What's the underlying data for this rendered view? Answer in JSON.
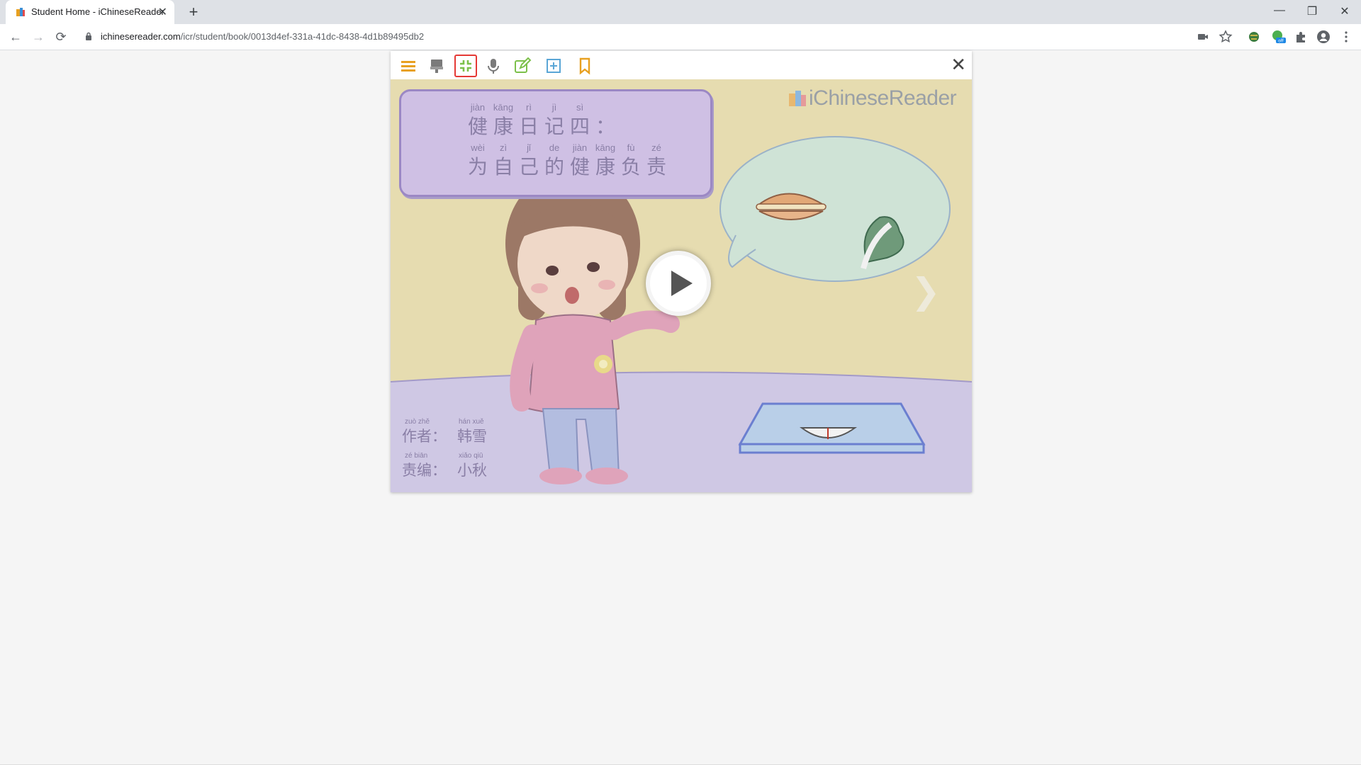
{
  "browser": {
    "tab_title": "Student Home - iChineseReader",
    "url_host": "ichinesereader.com",
    "url_path": "/icr/student/book/0013d4ef-331a-41dc-8438-4d1b89495db2",
    "new_tab_glyph": "+",
    "tab_close_glyph": "✕",
    "window_controls": {
      "minimize": "—",
      "maximize": "❐",
      "close": "✕"
    },
    "nav": {
      "back": "←",
      "forward": "→",
      "reload": "⟳"
    }
  },
  "reader": {
    "close_glyph": "✕",
    "toolbar_icons": [
      "menu-icon",
      "stamp-icon",
      "fullscreen-exit-icon",
      "microphone-icon",
      "edit-icon",
      "add-icon",
      "bookmark-icon"
    ],
    "colors": {
      "accent_orange": "#e8a020",
      "icon_gray": "#7a7a7a",
      "icon_green": "#7cc04a",
      "icon_blue": "#5aa6d6",
      "active_outline": "#e53935"
    },
    "brand": {
      "prefix": "i",
      "name": "ChineseReader"
    },
    "title": {
      "line1": [
        {
          "pinyin": "jiàn",
          "hanzi": "健"
        },
        {
          "pinyin": "kāng",
          "hanzi": "康"
        },
        {
          "pinyin": "rì",
          "hanzi": "日"
        },
        {
          "pinyin": "jì",
          "hanzi": "记"
        },
        {
          "pinyin": "sì",
          "hanzi": "四"
        },
        {
          "pinyin": "",
          "hanzi": "："
        }
      ],
      "line2": [
        {
          "pinyin": "wèi",
          "hanzi": "为"
        },
        {
          "pinyin": "zì",
          "hanzi": "自"
        },
        {
          "pinyin": "jǐ",
          "hanzi": "己"
        },
        {
          "pinyin": "de",
          "hanzi": "的"
        },
        {
          "pinyin": "jiàn",
          "hanzi": "健"
        },
        {
          "pinyin": "kāng",
          "hanzi": "康"
        },
        {
          "pinyin": "fù",
          "hanzi": "负"
        },
        {
          "pinyin": "zé",
          "hanzi": "责"
        }
      ]
    },
    "credits": {
      "author": {
        "label_pinyin": "zuò  zhě",
        "label": "作者：",
        "name_pinyin": "hán  xuě",
        "name": "韩雪"
      },
      "editor": {
        "label_pinyin": "zé  biān",
        "label": "责编：",
        "name_pinyin": "xiǎo  qiū",
        "name": "小秋"
      }
    },
    "next_arrow": "❯"
  }
}
